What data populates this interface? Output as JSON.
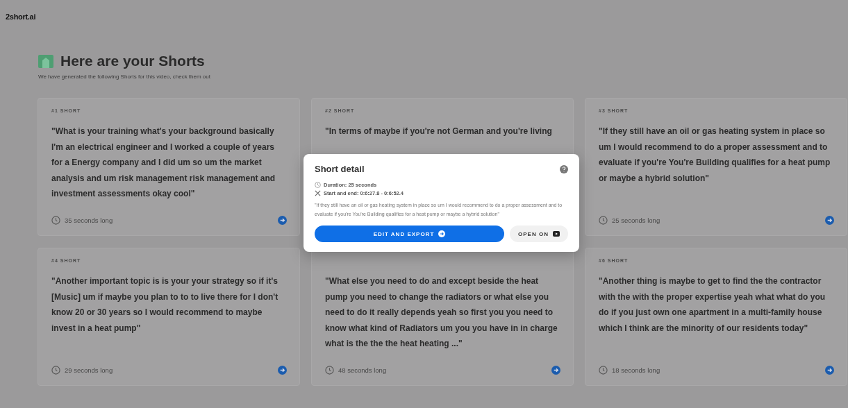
{
  "logo": "2short.ai",
  "heading": {
    "title": "Here are your Shorts",
    "subtitle": "We have generated the following Shorts for this video, check them out"
  },
  "shorts": [
    {
      "label": "#1 SHORT",
      "quote": "\"What is your training what's your background basically I'm an electrical engineer and I worked a couple of years for a Energy company and I did um so um the market analysis and um risk management risk management and investment assessments okay cool\"",
      "duration": "35 seconds long"
    },
    {
      "label": "#2 SHORT",
      "quote": "\"In terms of maybe if you're not German and you're living"
    },
    {
      "label": "#3 SHORT",
      "quote": "\"If they still have an oil or gas heating system in place so um I would recommend to do a proper assessment and to evaluate if you're You're Building qualifies for a heat pump or maybe a hybrid solution\"",
      "duration": "25 seconds long"
    },
    {
      "label": "#4 SHORT",
      "quote": "\"Another important topic is is your your strategy so if it's [Music] um if maybe you plan to to to live there for I don't know 20 or 30 years so I would recommend to maybe invest in a heat pump\"",
      "duration": "29 seconds long"
    },
    {
      "quote": "\"What else you need to do and except beside the heat pump you need to change the radiators or what else you need to do it really depends yeah so first you you need to know what kind of Radiators um you you have in in charge what is the the the heat heating ...\"",
      "duration": "48 seconds long"
    },
    {
      "label": "#6 SHORT",
      "quote": "\"Another thing is maybe to get to find the the contractor with the with the proper expertise yeah what what do you do if you just own one apartment in a multi-family house which I think are the minority of our residents today\"",
      "duration": "18 seconds long"
    }
  ],
  "dialog": {
    "title": "Short detail",
    "duration": "Duration: 25 seconds",
    "range": "Start and end: 0:6:27.8 - 0:6:52.4",
    "quote": "\"If they still have an oil or gas heating system in place so um I would recommend to do a proper assessment and to evaluate if you're You're Building qualifies for a heat pump or maybe a hybrid solution\"",
    "primary": "EDIT AND EXPORT",
    "secondary": "OPEN ON"
  }
}
